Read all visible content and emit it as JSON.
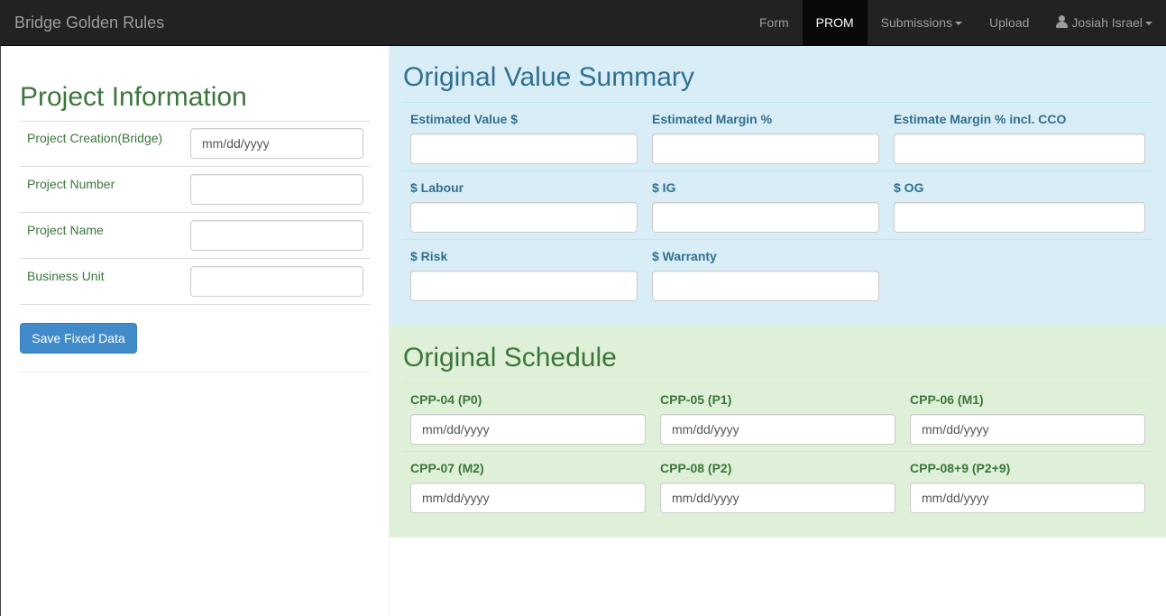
{
  "navbar": {
    "brand": "Bridge Golden Rules",
    "items": [
      {
        "label": "Form"
      },
      {
        "label": "PROM"
      },
      {
        "label": "Submissions"
      },
      {
        "label": "Upload"
      }
    ],
    "user": "Josiah Israel"
  },
  "project_info": {
    "title": "Project Information",
    "fields": [
      {
        "label": "Project Creation(Bridge)",
        "placeholder": "mm/dd/yyyy"
      },
      {
        "label": "Project Number",
        "placeholder": ""
      },
      {
        "label": "Project Name",
        "placeholder": ""
      },
      {
        "label": "Business Unit",
        "placeholder": ""
      }
    ],
    "save_label": "Save Fixed Data"
  },
  "value_summary": {
    "title": "Original Value Summary",
    "fields": [
      {
        "label": "Estimated Value $",
        "value": ""
      },
      {
        "label": "Estimated Margin %",
        "value": ""
      },
      {
        "label": "Estimate Margin % incl. CCO",
        "value": ""
      },
      {
        "label": "$ Labour",
        "value": ""
      },
      {
        "label": "$ IG",
        "value": ""
      },
      {
        "label": "$ OG",
        "value": ""
      },
      {
        "label": "$ Risk",
        "value": ""
      },
      {
        "label": "$ Warranty",
        "value": ""
      }
    ]
  },
  "schedule": {
    "title": "Original Schedule",
    "fields": [
      {
        "label": "CPP-04 (P0)",
        "placeholder": "mm/dd/yyyy"
      },
      {
        "label": "CPP-05 (P1)",
        "placeholder": "mm/dd/yyyy"
      },
      {
        "label": "CPP-06 (M1)",
        "placeholder": "mm/dd/yyyy"
      },
      {
        "label": "CPP-07 (M2)",
        "placeholder": "mm/dd/yyyy"
      },
      {
        "label": "CPP-08 (P2)",
        "placeholder": "mm/dd/yyyy"
      },
      {
        "label": "CPP-08+9 (P2+9)",
        "placeholder": "mm/dd/yyyy"
      }
    ]
  }
}
